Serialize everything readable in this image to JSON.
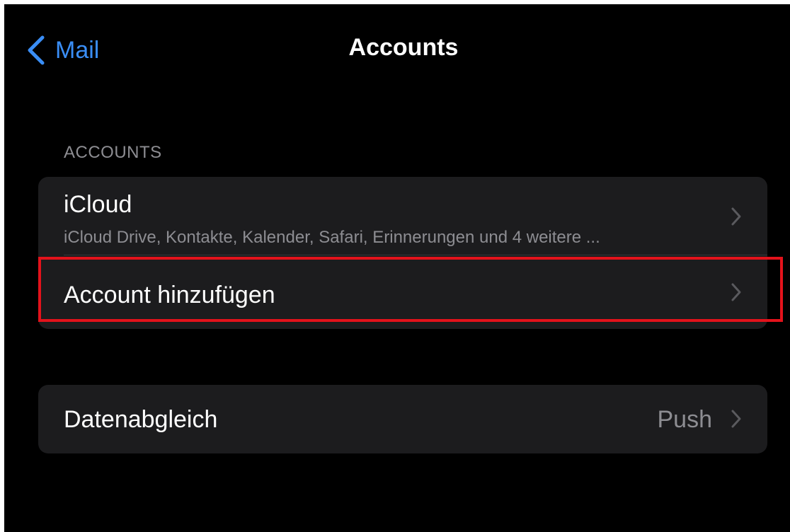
{
  "navbar": {
    "back_label": "Mail",
    "title": "Accounts",
    "accent_color": "#3a8ef6"
  },
  "accounts_section": {
    "header": "ACCOUNTS",
    "items": [
      {
        "title": "iCloud",
        "subtitle": "iCloud Drive, Kontakte, Kalender, Safari, Erinnerungen und 4 weitere ...",
        "icon": "chevron-right-icon"
      },
      {
        "title": "Account hinzufügen",
        "icon": "chevron-right-icon",
        "highlighted": true,
        "highlight_color": "#e3121b"
      }
    ]
  },
  "sync_section": {
    "items": [
      {
        "title": "Datenabgleich",
        "value": "Push",
        "icon": "chevron-right-icon"
      }
    ]
  }
}
